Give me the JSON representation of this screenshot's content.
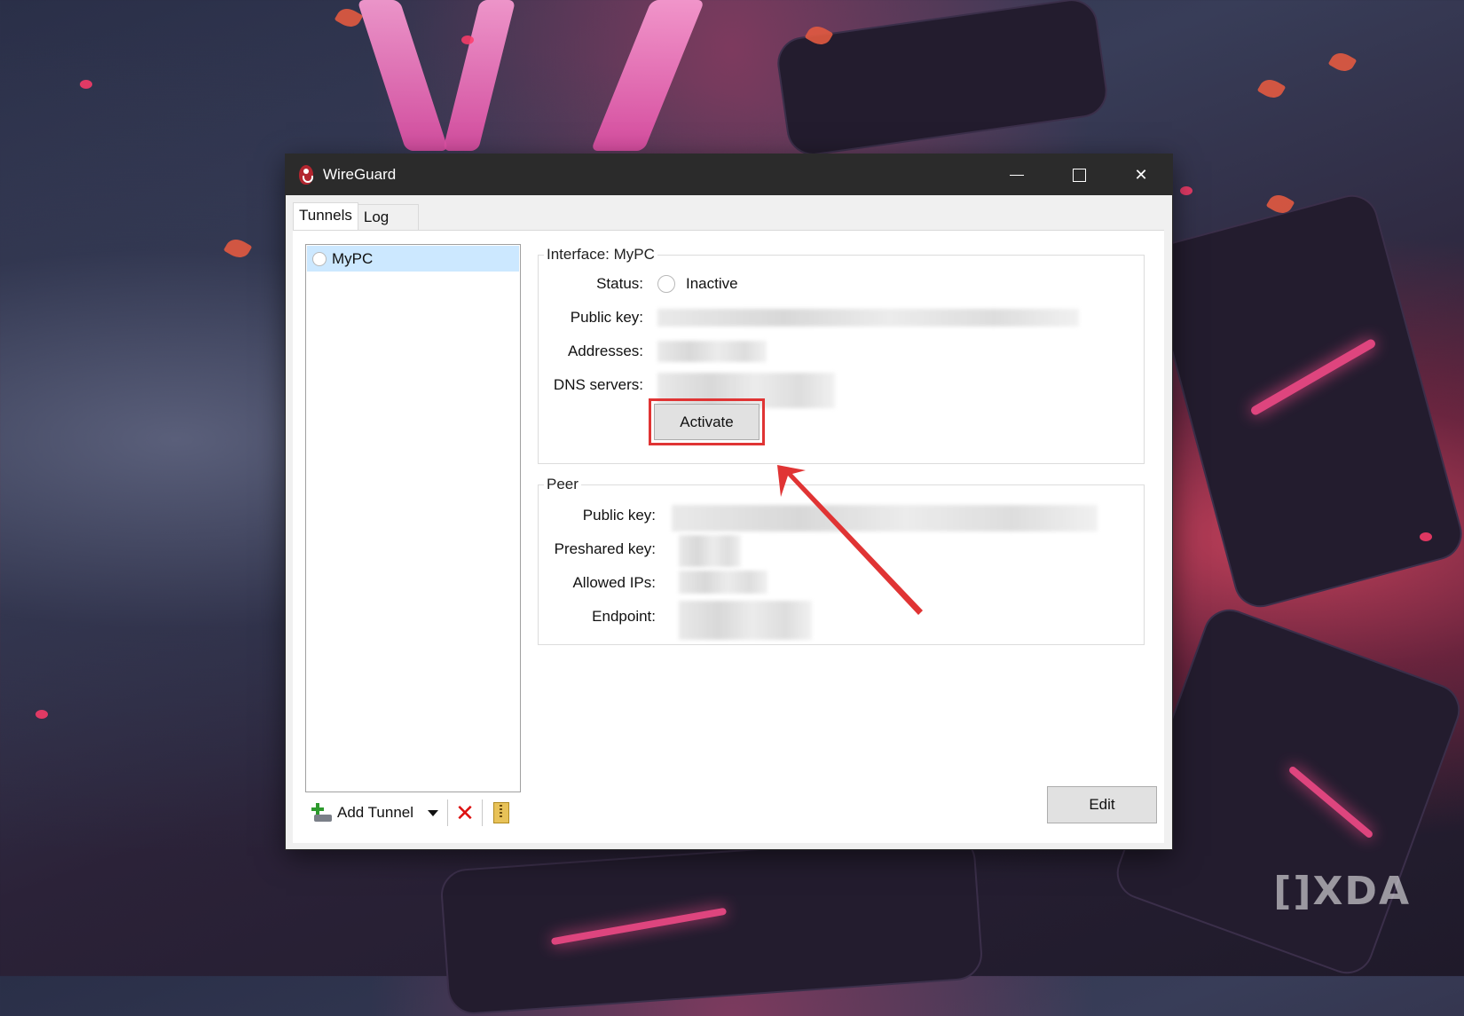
{
  "window": {
    "title": "WireGuard"
  },
  "tabs": [
    {
      "label": "Tunnels",
      "active": true
    },
    {
      "label": "Log",
      "active": false
    }
  ],
  "tunnels": [
    {
      "name": "MyPC",
      "selected": true
    }
  ],
  "toolbar": {
    "add_tunnel_label": "Add Tunnel"
  },
  "interface": {
    "title": "Interface: MyPC",
    "status_label": "Status:",
    "status_value": "Inactive",
    "public_key_label": "Public key:",
    "addresses_label": "Addresses:",
    "dns_servers_label": "DNS servers:",
    "activate_label": "Activate"
  },
  "peer": {
    "title": "Peer",
    "public_key_label": "Public key:",
    "preshared_key_label": "Preshared key:",
    "allowed_ips_label": "Allowed IPs:",
    "endpoint_label": "Endpoint:"
  },
  "edit_label": "Edit",
  "watermark": "[]XDA",
  "colors": {
    "highlight": "#e03434",
    "selection": "#cce8ff",
    "titlebar": "#2b2b2b"
  }
}
